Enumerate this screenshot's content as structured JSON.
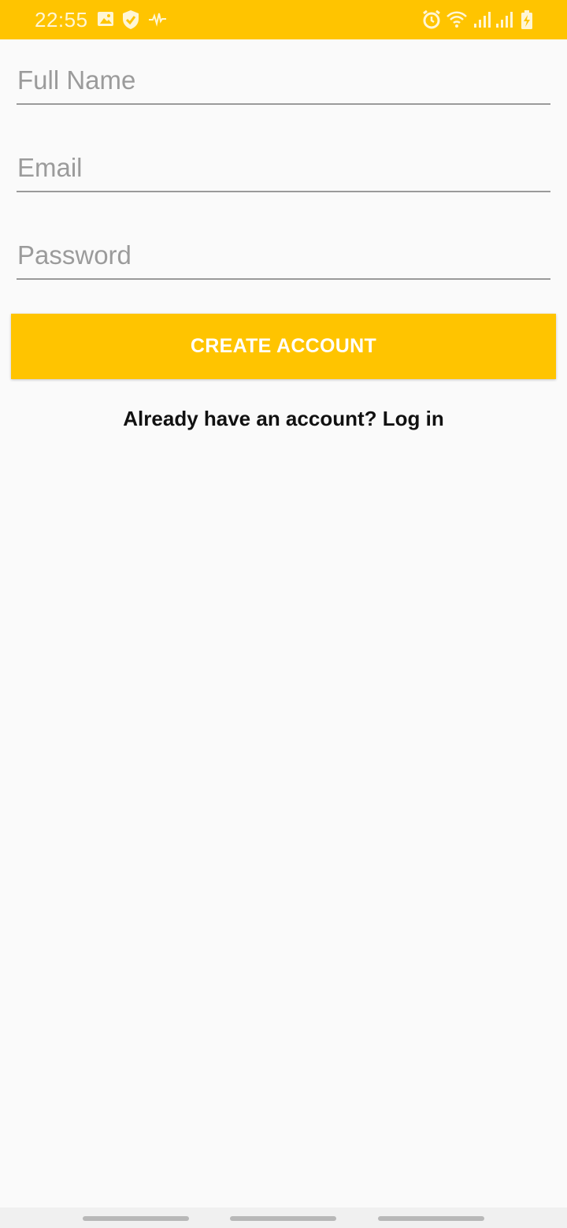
{
  "status_bar": {
    "time": "22:55",
    "background": "#ffc400",
    "left_icons": [
      "image-icon",
      "shield-check-icon",
      "audio-wave-icon"
    ],
    "right_icons": [
      "alarm-icon",
      "wifi-icon",
      "signal-icon",
      "signal-icon",
      "battery-charging-icon"
    ]
  },
  "form": {
    "full_name": {
      "value": "",
      "placeholder": "Full Name"
    },
    "email": {
      "value": "",
      "placeholder": "Email"
    },
    "password": {
      "value": "",
      "placeholder": "Password"
    },
    "create_button_label": "CREATE ACCOUNT",
    "login_link_label": "Already have an account? Log in"
  },
  "colors": {
    "accent": "#ffc400",
    "background": "#fafafa",
    "underline": "#9a9a9a",
    "placeholder": "#9b9b9b"
  },
  "navigation_bar": {
    "items": [
      "recent-apps",
      "home",
      "back"
    ]
  }
}
